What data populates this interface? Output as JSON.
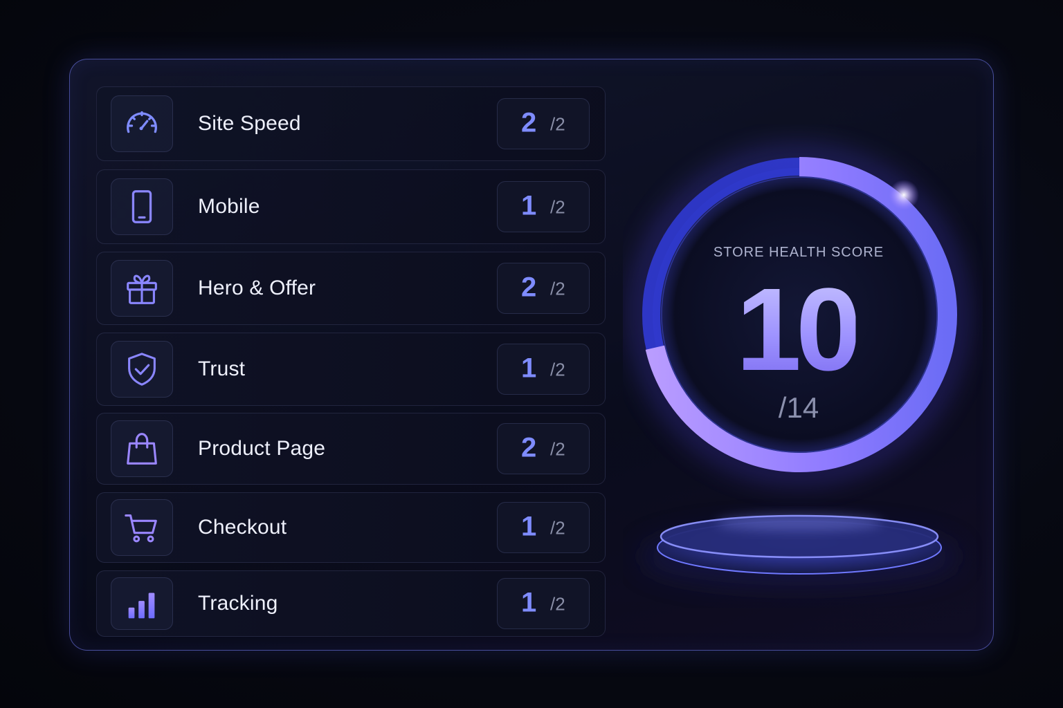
{
  "categories": [
    {
      "label": "Site Speed",
      "score": "2",
      "max": "/2",
      "icon": "speedometer-icon"
    },
    {
      "label": "Mobile",
      "score": "1",
      "max": "/2",
      "icon": "mobile-phone-icon"
    },
    {
      "label": "Hero & Offer",
      "score": "2",
      "max": "/2",
      "icon": "gift-icon"
    },
    {
      "label": "Trust",
      "score": "1",
      "max": "/2",
      "icon": "shield-check-icon"
    },
    {
      "label": "Product Page",
      "score": "2",
      "max": "/2",
      "icon": "shopping-bag-icon"
    },
    {
      "label": "Checkout",
      "score": "1",
      "max": "/2",
      "icon": "shopping-cart-icon"
    },
    {
      "label": "Tracking",
      "score": "1",
      "max": "/2",
      "icon": "bar-chart-icon"
    }
  ],
  "health": {
    "title": "STORE HEALTH SCORE",
    "value": "10",
    "max": "/14",
    "progress_fraction": 0.714
  },
  "colors": {
    "accent_blue": "#7f8cff",
    "accent_violet": "#a78bfa",
    "ring_blue": "#4b57f0",
    "ring_violet": "#b48cff",
    "background": "#070912"
  }
}
